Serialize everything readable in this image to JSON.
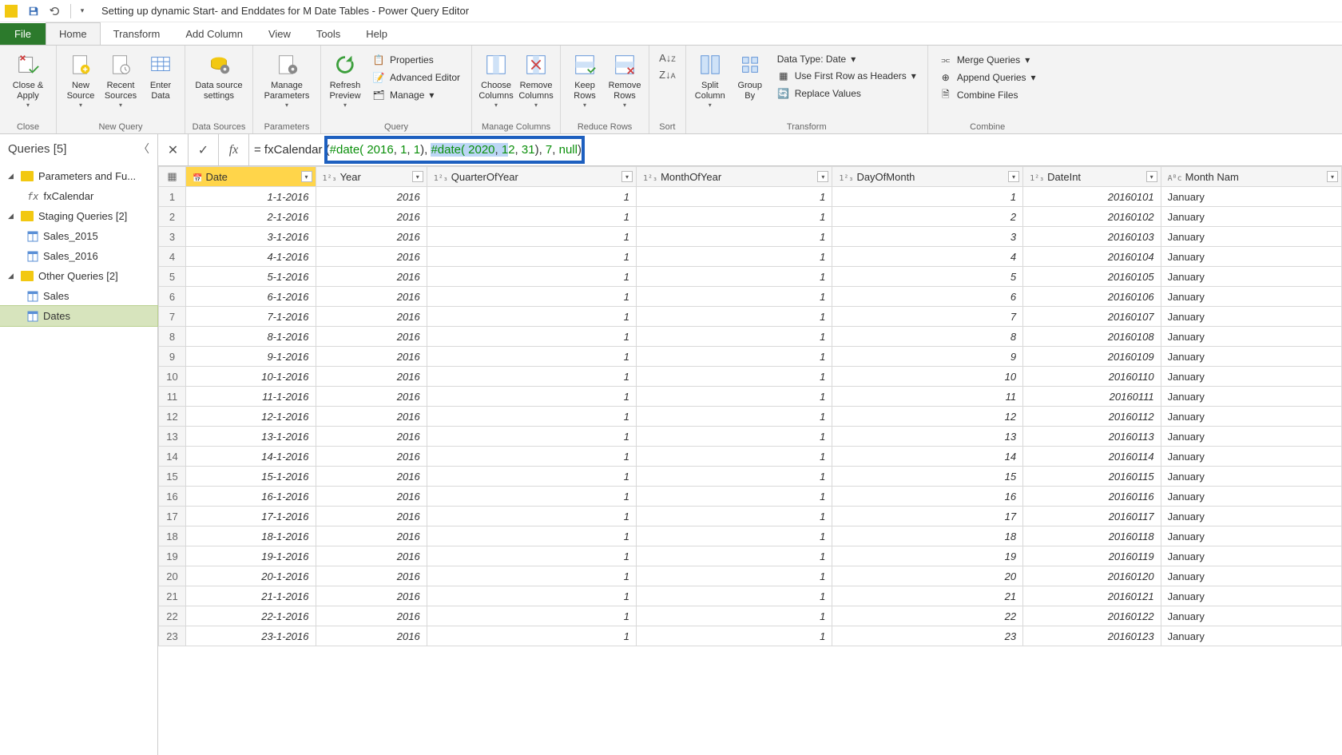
{
  "titlebar": {
    "title": "Setting up dynamic Start- and Enddates for M Date Tables - Power Query Editor"
  },
  "tabs": {
    "file": "File",
    "home": "Home",
    "transform": "Transform",
    "add_column": "Add Column",
    "view": "View",
    "tools": "Tools",
    "help": "Help"
  },
  "ribbon": {
    "close_apply": "Close &\nApply",
    "close_group": "Close",
    "new_source": "New\nSource",
    "recent_sources": "Recent\nSources",
    "enter_data": "Enter\nData",
    "new_query_group": "New Query",
    "data_source_settings": "Data source\nsettings",
    "data_sources_group": "Data Sources",
    "manage_parameters": "Manage\nParameters",
    "parameters_group": "Parameters",
    "refresh_preview": "Refresh\nPreview",
    "properties": "Properties",
    "advanced_editor": "Advanced Editor",
    "manage": "Manage",
    "query_group": "Query",
    "choose_columns": "Choose\nColumns",
    "remove_columns": "Remove\nColumns",
    "manage_columns_group": "Manage Columns",
    "keep_rows": "Keep\nRows",
    "remove_rows": "Remove\nRows",
    "reduce_rows_group": "Reduce Rows",
    "sort_group": "Sort",
    "split_column": "Split\nColumn",
    "group_by": "Group\nBy",
    "data_type": "Data Type: Date",
    "first_row_headers": "Use First Row as Headers",
    "replace_values": "Replace Values",
    "transform_group": "Transform",
    "merge_queries": "Merge Queries",
    "append_queries": "Append Queries",
    "combine_files": "Combine Files",
    "combine_group": "Combine"
  },
  "queries_panel": {
    "header": "Queries [5]",
    "groups": [
      {
        "label": "Parameters and Fu...",
        "items": [
          {
            "type": "fx",
            "label": "fxCalendar"
          }
        ]
      },
      {
        "label": "Staging Queries [2]",
        "items": [
          {
            "type": "table",
            "label": "Sales_2015"
          },
          {
            "type": "table",
            "label": "Sales_2016"
          }
        ]
      },
      {
        "label": "Other Queries [2]",
        "items": [
          {
            "type": "table",
            "label": "Sales"
          },
          {
            "type": "table",
            "label": "Dates",
            "selected": true
          }
        ]
      }
    ]
  },
  "formula": {
    "prefix": "= fxCalendar ",
    "p_open": "#date( ",
    "y1": "2016",
    "c": ", ",
    "m1": "1",
    "d1": "1",
    "close1": "), ",
    "date2": "#date( ",
    "y2": "2020",
    "m2_a": "1",
    "m2_b": "2",
    "d2": "31",
    "close2": "), ",
    "seven": "7",
    "nullv": "null",
    "endp": ")"
  },
  "columns": [
    "Date",
    "Year",
    "QuarterOfYear",
    "MonthOfYear",
    "DayOfMonth",
    "DateInt",
    "Month Nam"
  ],
  "col_types": [
    "📅",
    "1²₃",
    "1²₃",
    "1²₃",
    "1²₃",
    "1²₃",
    "Aᴮc"
  ],
  "rows": [
    {
      "n": 1,
      "date": "1-1-2016",
      "year": "2016",
      "q": "1",
      "m": "1",
      "d": "1",
      "di": "20160101",
      "mn": "January"
    },
    {
      "n": 2,
      "date": "2-1-2016",
      "year": "2016",
      "q": "1",
      "m": "1",
      "d": "2",
      "di": "20160102",
      "mn": "January"
    },
    {
      "n": 3,
      "date": "3-1-2016",
      "year": "2016",
      "q": "1",
      "m": "1",
      "d": "3",
      "di": "20160103",
      "mn": "January"
    },
    {
      "n": 4,
      "date": "4-1-2016",
      "year": "2016",
      "q": "1",
      "m": "1",
      "d": "4",
      "di": "20160104",
      "mn": "January"
    },
    {
      "n": 5,
      "date": "5-1-2016",
      "year": "2016",
      "q": "1",
      "m": "1",
      "d": "5",
      "di": "20160105",
      "mn": "January"
    },
    {
      "n": 6,
      "date": "6-1-2016",
      "year": "2016",
      "q": "1",
      "m": "1",
      "d": "6",
      "di": "20160106",
      "mn": "January"
    },
    {
      "n": 7,
      "date": "7-1-2016",
      "year": "2016",
      "q": "1",
      "m": "1",
      "d": "7",
      "di": "20160107",
      "mn": "January"
    },
    {
      "n": 8,
      "date": "8-1-2016",
      "year": "2016",
      "q": "1",
      "m": "1",
      "d": "8",
      "di": "20160108",
      "mn": "January"
    },
    {
      "n": 9,
      "date": "9-1-2016",
      "year": "2016",
      "q": "1",
      "m": "1",
      "d": "9",
      "di": "20160109",
      "mn": "January"
    },
    {
      "n": 10,
      "date": "10-1-2016",
      "year": "2016",
      "q": "1",
      "m": "1",
      "d": "10",
      "di": "20160110",
      "mn": "January"
    },
    {
      "n": 11,
      "date": "11-1-2016",
      "year": "2016",
      "q": "1",
      "m": "1",
      "d": "11",
      "di": "20160111",
      "mn": "January"
    },
    {
      "n": 12,
      "date": "12-1-2016",
      "year": "2016",
      "q": "1",
      "m": "1",
      "d": "12",
      "di": "20160112",
      "mn": "January"
    },
    {
      "n": 13,
      "date": "13-1-2016",
      "year": "2016",
      "q": "1",
      "m": "1",
      "d": "13",
      "di": "20160113",
      "mn": "January"
    },
    {
      "n": 14,
      "date": "14-1-2016",
      "year": "2016",
      "q": "1",
      "m": "1",
      "d": "14",
      "di": "20160114",
      "mn": "January"
    },
    {
      "n": 15,
      "date": "15-1-2016",
      "year": "2016",
      "q": "1",
      "m": "1",
      "d": "15",
      "di": "20160115",
      "mn": "January"
    },
    {
      "n": 16,
      "date": "16-1-2016",
      "year": "2016",
      "q": "1",
      "m": "1",
      "d": "16",
      "di": "20160116",
      "mn": "January"
    },
    {
      "n": 17,
      "date": "17-1-2016",
      "year": "2016",
      "q": "1",
      "m": "1",
      "d": "17",
      "di": "20160117",
      "mn": "January"
    },
    {
      "n": 18,
      "date": "18-1-2016",
      "year": "2016",
      "q": "1",
      "m": "1",
      "d": "18",
      "di": "20160118",
      "mn": "January"
    },
    {
      "n": 19,
      "date": "19-1-2016",
      "year": "2016",
      "q": "1",
      "m": "1",
      "d": "19",
      "di": "20160119",
      "mn": "January"
    },
    {
      "n": 20,
      "date": "20-1-2016",
      "year": "2016",
      "q": "1",
      "m": "1",
      "d": "20",
      "di": "20160120",
      "mn": "January"
    },
    {
      "n": 21,
      "date": "21-1-2016",
      "year": "2016",
      "q": "1",
      "m": "1",
      "d": "21",
      "di": "20160121",
      "mn": "January"
    },
    {
      "n": 22,
      "date": "22-1-2016",
      "year": "2016",
      "q": "1",
      "m": "1",
      "d": "22",
      "di": "20160122",
      "mn": "January"
    },
    {
      "n": 23,
      "date": "23-1-2016",
      "year": "2016",
      "q": "1",
      "m": "1",
      "d": "23",
      "di": "20160123",
      "mn": "January"
    }
  ]
}
